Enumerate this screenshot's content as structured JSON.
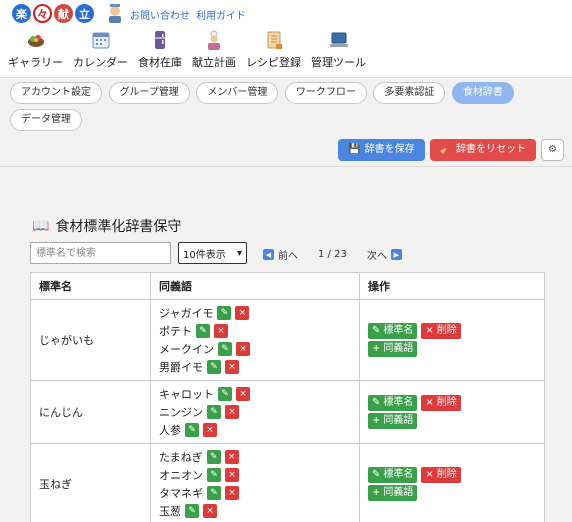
{
  "header": {
    "logo_chars": [
      "楽",
      "々",
      "献",
      "立"
    ],
    "links": [
      "お問い合わせ",
      "利用ガイド"
    ],
    "nav": [
      {
        "label": "ギャラリー",
        "icon": "salad-icon"
      },
      {
        "label": "カレンダー",
        "icon": "calendar-icon"
      },
      {
        "label": "食材在庫",
        "icon": "fridge-icon"
      },
      {
        "label": "献立計画",
        "icon": "chef-icon"
      },
      {
        "label": "レシピ登録",
        "icon": "recipe-scroll-icon"
      },
      {
        "label": "管理ツール",
        "icon": "laptop-icon"
      }
    ]
  },
  "tabs": [
    "アカウント設定",
    "グループ管理",
    "メンバー管理",
    "ワークフロー",
    "多要素認証",
    "食材辞書",
    "データ管理"
  ],
  "active_tab": "食材辞書",
  "actions": {
    "save_label": "辞書を保存",
    "reset_label": "辞書をリセット",
    "gear": "⚙"
  },
  "section": {
    "title": "食材標準化辞書保守",
    "search_placeholder": "標準名で検索",
    "per_page": "10件表示",
    "pager": {
      "prev": "前へ",
      "page": "1 / 23",
      "next": "次へ"
    }
  },
  "table": {
    "headers": [
      "標準名",
      "同義語",
      "操作"
    ],
    "rows": [
      {
        "name": "じゃがいも",
        "synonyms": [
          "ジャガイモ",
          "ポテト",
          "メークイン",
          "男爵イモ"
        ]
      },
      {
        "name": "にんじん",
        "synonyms": [
          "キャロット",
          "ニンジン",
          "人参"
        ]
      },
      {
        "name": "玉ねぎ",
        "synonyms": [
          "たまねぎ",
          "オニオン",
          "タマネギ",
          "玉葱"
        ]
      }
    ],
    "op_labels": {
      "rename": "標準名",
      "delete": "削除",
      "add_synonym": "同義語"
    }
  },
  "colors": {
    "accent": "#4a86e0",
    "danger": "#e24b4b",
    "success": "#3aa04a",
    "active_tab": "#8fb6ee"
  }
}
